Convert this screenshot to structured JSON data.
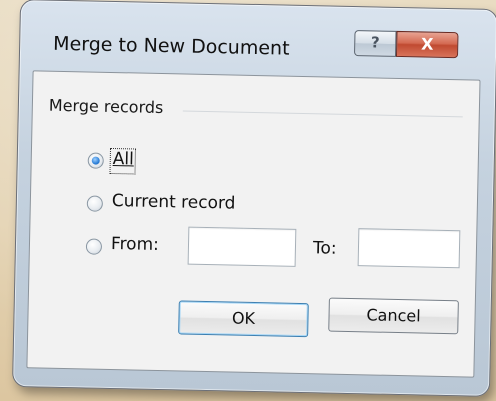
{
  "window": {
    "title": "Merge to New Document",
    "help_glyph": "?",
    "close_glyph": "X"
  },
  "group": {
    "label": "Merge records"
  },
  "options": {
    "all_label": "All",
    "current_label": "Current record",
    "from_label": "From:",
    "to_label": "To:",
    "selected": "all"
  },
  "fields": {
    "from_value": "",
    "to_value": ""
  },
  "buttons": {
    "ok_label": "OK",
    "cancel_label": "Cancel"
  },
  "colors": {
    "accent": "#2b7fd8",
    "close_button": "#c04a31"
  }
}
